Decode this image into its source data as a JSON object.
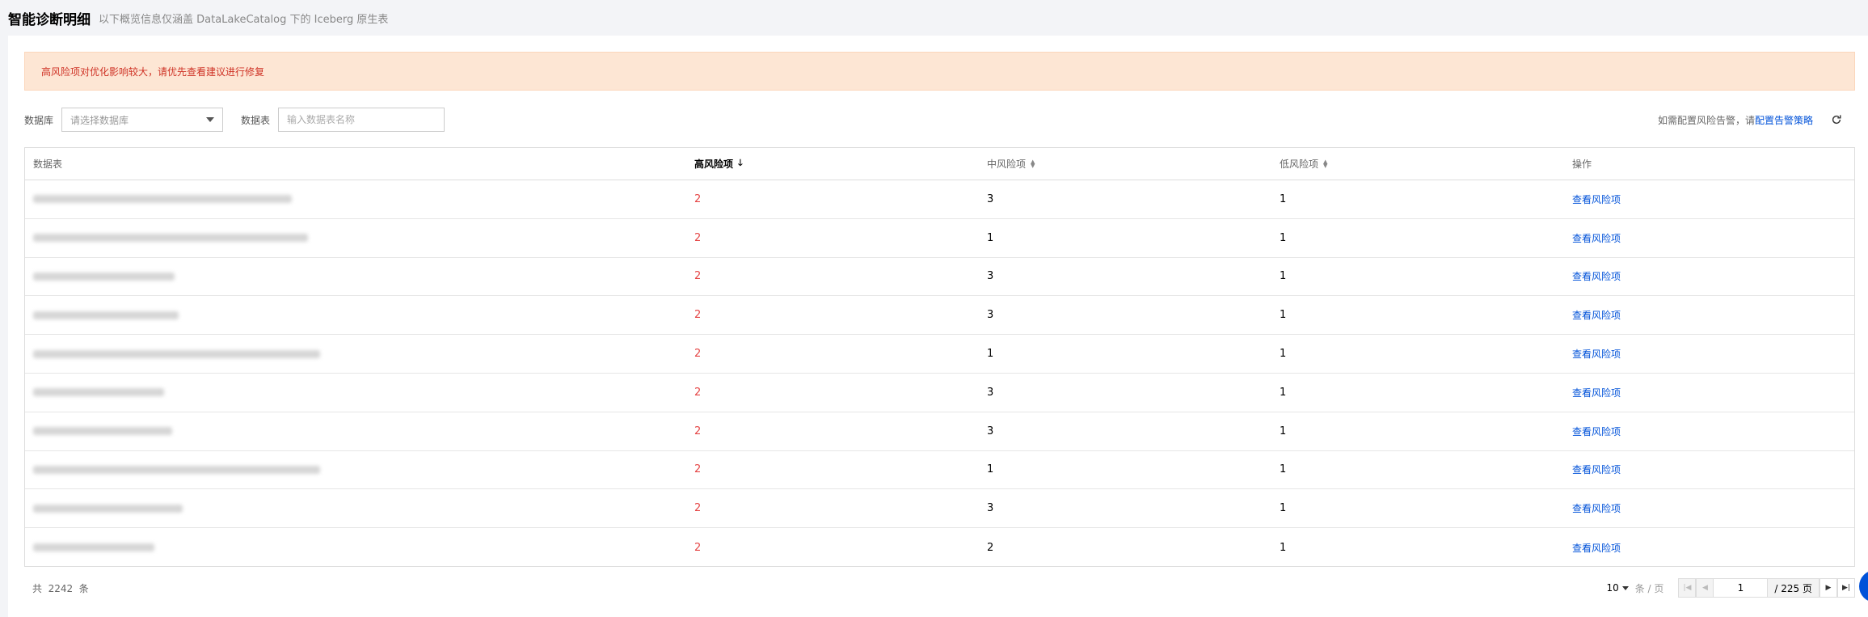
{
  "header": {
    "title": "智能诊断明细",
    "description": "以下概览信息仅涵盖 DataLakeCatalog 下的 Iceberg 原生表"
  },
  "alert": {
    "text": "高风险项对优化影响较大，请优先查看建议进行修复"
  },
  "filters": {
    "db_label": "数据库",
    "db_placeholder": "请选择数据库",
    "table_label": "数据表",
    "table_placeholder": "输入数据表名称",
    "alert_hint": "如需配置风险告警，请",
    "alert_link": "配置告警策略"
  },
  "table": {
    "columns": {
      "name": "数据表",
      "high": "高风险项",
      "mid": "中风险项",
      "low": "低风险项",
      "op": "操作"
    },
    "op_label": "查看风险项",
    "rows": [
      {
        "high": "2",
        "mid": "3",
        "low": "1"
      },
      {
        "high": "2",
        "mid": "1",
        "low": "1"
      },
      {
        "high": "2",
        "mid": "3",
        "low": "1"
      },
      {
        "high": "2",
        "mid": "3",
        "low": "1"
      },
      {
        "high": "2",
        "mid": "1",
        "low": "1"
      },
      {
        "high": "2",
        "mid": "3",
        "low": "1"
      },
      {
        "high": "2",
        "mid": "3",
        "low": "1"
      },
      {
        "high": "2",
        "mid": "1",
        "low": "1"
      },
      {
        "high": "2",
        "mid": "3",
        "low": "1"
      },
      {
        "high": "2",
        "mid": "2",
        "low": "1"
      }
    ]
  },
  "pagination": {
    "total_text": "共  2242  条",
    "page_size": "10",
    "per_page_label": "条 / 页",
    "current_page": "1",
    "total_pages_text": "/ 225 页"
  },
  "colors": {
    "accent": "#0052d9",
    "danger": "#e54545",
    "alert_bg": "#fde6d4"
  }
}
